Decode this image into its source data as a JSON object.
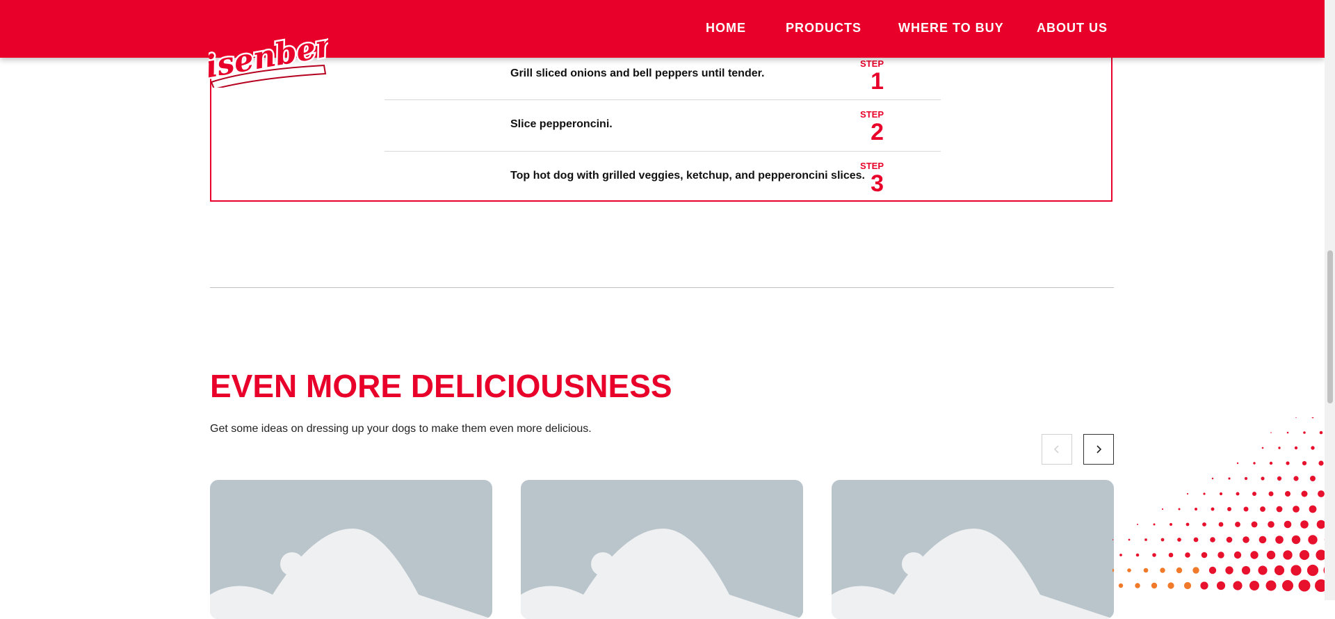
{
  "header": {
    "logo_text": "Eisenberg",
    "nav": [
      "HOME",
      "PRODUCTS",
      "WHERE TO BUY",
      "ABOUT US"
    ],
    "color": "#e8002a"
  },
  "steps": [
    {
      "label": "STEP",
      "num": "1",
      "text": "Grill sliced onions and bell peppers until tender."
    },
    {
      "label": "STEP",
      "num": "2",
      "text": "Slice pepperoncini."
    },
    {
      "label": "STEP",
      "num": "3",
      "text": "Top hot dog with grilled veggies, ketchup, and pepperoncini slices."
    }
  ],
  "more": {
    "title": "EVEN MORE DELICIOUSNESS",
    "subtitle": "Get some ideas on dressing up your dogs to make them even more delicious.",
    "prev_icon": "chevron-left-icon",
    "next_icon": "chevron-right-icon"
  },
  "cards": [
    {
      "icon": "image-placeholder-icon"
    },
    {
      "icon": "image-placeholder-icon"
    },
    {
      "icon": "image-placeholder-icon"
    }
  ]
}
